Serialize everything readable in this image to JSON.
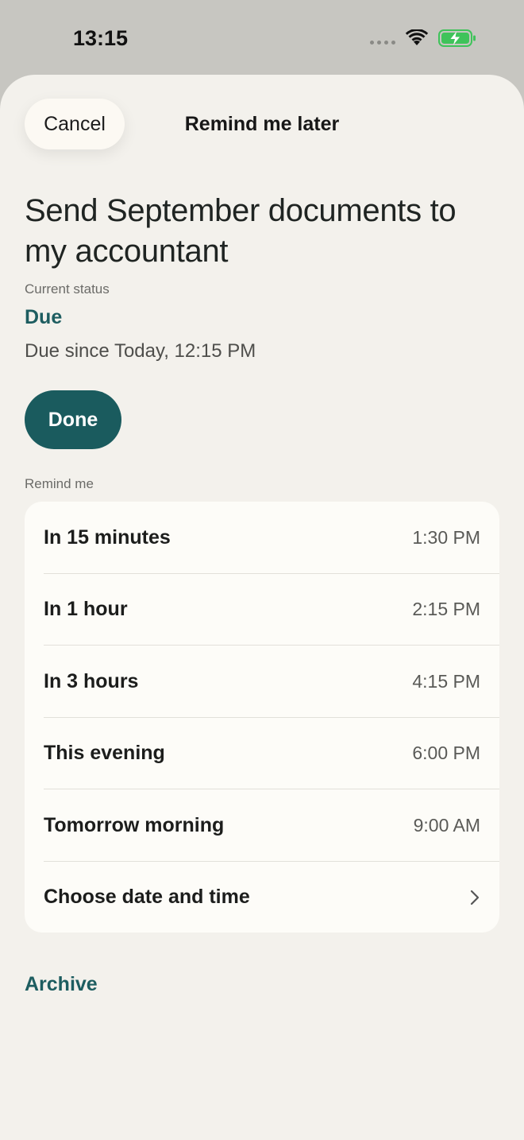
{
  "status_bar": {
    "time": "13:15",
    "icons": [
      "cellular-signal-icon",
      "wifi-icon",
      "battery-charging-icon"
    ]
  },
  "header": {
    "cancel_label": "Cancel",
    "title": "Remind me later"
  },
  "task": {
    "title": "Send September documents to my accountant",
    "status_caption": "Current status",
    "status": "Due",
    "due_since": "Due since Today, 12:15 PM",
    "done_label": "Done"
  },
  "remind": {
    "caption": "Remind me",
    "options": [
      {
        "label": "In 15 minutes",
        "time": "1:30 PM"
      },
      {
        "label": "In 1 hour",
        "time": "2:15 PM"
      },
      {
        "label": "In 3 hours",
        "time": "4:15 PM"
      },
      {
        "label": "This evening",
        "time": "6:00 PM"
      },
      {
        "label": "Tomorrow morning",
        "time": "9:00 AM"
      },
      {
        "label": "Choose date and time",
        "icon": "chevron-right-icon"
      }
    ]
  },
  "archive_label": "Archive",
  "colors": {
    "accent": "#1a5b5e",
    "sheet_background": "#f3f1ec",
    "card_background": "#fdfcf8",
    "battery": "#3fc35a"
  }
}
